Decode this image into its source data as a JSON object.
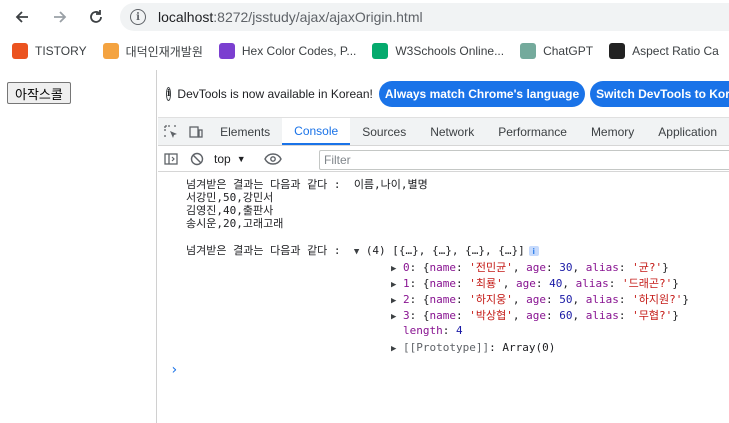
{
  "browser": {
    "url_host": "localhost",
    "url_rest": ":8272/jsstudy/ajax/ajaxOrigin.html",
    "bookmarks": [
      {
        "label": "TISTORY",
        "icon": "tistory-icon",
        "color": "#eb531f"
      },
      {
        "label": "대덕인재개발원",
        "icon": "ddit-icon",
        "color": "#f4a340"
      },
      {
        "label": "Hex Color Codes, P...",
        "icon": "hex-color-icon",
        "color": "#7b3fd0"
      },
      {
        "label": "W3Schools Online...",
        "icon": "w3schools-icon",
        "color": "#04aa6d"
      },
      {
        "label": "ChatGPT",
        "icon": "chatgpt-icon",
        "color": "#74aa9c"
      },
      {
        "label": "Aspect Ratio Ca",
        "icon": "aspect-ratio-icon",
        "color": "#222222"
      }
    ]
  },
  "page": {
    "button_label": "아작스콜"
  },
  "devtools": {
    "notice_text": "DevTools is now available in Korean!",
    "btn_match_language": "Always match Chrome's language",
    "btn_switch_korean": "Switch DevTools to Korean",
    "tabs": [
      "Elements",
      "Console",
      "Sources",
      "Network",
      "Performance",
      "Memory",
      "Application"
    ],
    "active_tab": "Console",
    "context": "top",
    "filter_placeholder": "Filter",
    "accent_color": "#1a73e8"
  },
  "console": {
    "msg1_prefix": "넘겨받은 결과는 다음과 같다 :  ",
    "msg1_lines": [
      "이름,나이,별명",
      "서강민,50,강민서",
      "김영진,40,출판사",
      "송시운,20,고래고래"
    ],
    "msg2_prefix": "넘겨받은 결과는 다음과 같다 :  ",
    "array_summary": "(4) [{…}, {…}, {…}, {…}]",
    "items": [
      {
        "index": "0",
        "name": "'전민균'",
        "age": "30",
        "alias": "'균?'"
      },
      {
        "index": "1",
        "name": "'최룡'",
        "age": "40",
        "alias": "'드래곤?'"
      },
      {
        "index": "2",
        "name": "'하지웅'",
        "age": "50",
        "alias": "'하지원?'"
      },
      {
        "index": "3",
        "name": "'박상협'",
        "age": "60",
        "alias": "'무협?'"
      }
    ],
    "length_label": "length",
    "length_value": "4",
    "prototype_label": "[[Prototype]]",
    "prototype_value": "Array(0)"
  }
}
